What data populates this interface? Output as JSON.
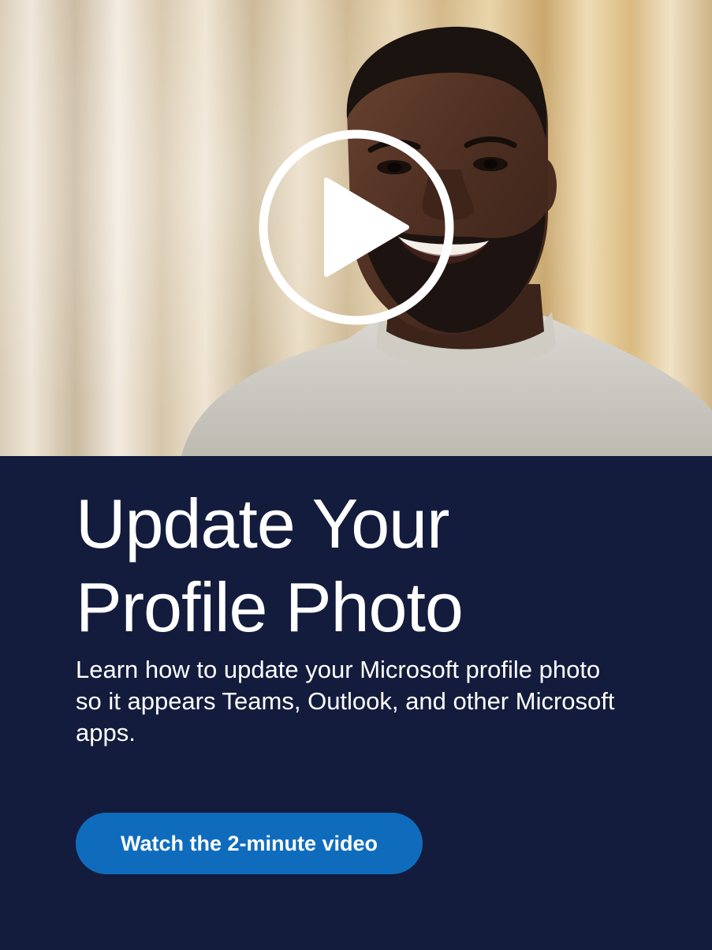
{
  "hero": {
    "image_description": "Smiling man with short hair and beard wearing a light gray turtleneck sweater, blurred warm curtain background",
    "play_icon": "play-circle-icon"
  },
  "content": {
    "title_line1": "Update Your",
    "title_line2": "Profile Photo",
    "description": "Learn how to update your Microsoft profile photo so it appears Teams, Outlook, and other Microsoft apps.",
    "cta_label": "Watch the 2-minute video"
  },
  "colors": {
    "panel_background": "#141c3d",
    "cta_background": "#0f6cbd",
    "text": "#ffffff"
  }
}
